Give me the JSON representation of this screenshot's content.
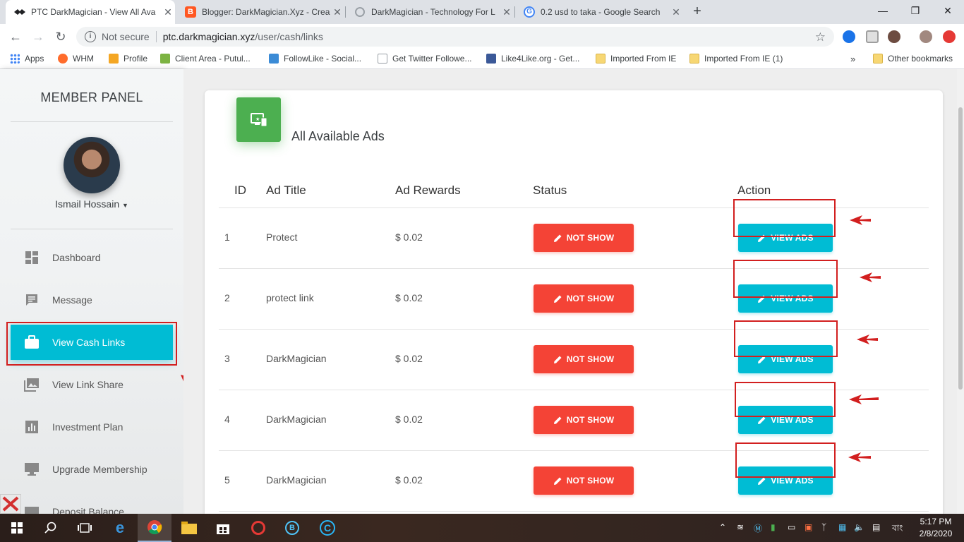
{
  "browser": {
    "tabs": [
      {
        "title": "PTC DarkMagician - View All Ava",
        "active": true
      },
      {
        "title": "Blogger: DarkMagician.Xyz - Crea",
        "active": false
      },
      {
        "title": "DarkMagician - Technology For L",
        "active": false
      },
      {
        "title": "0.2 usd to taka - Google Search",
        "active": false
      }
    ],
    "security_label": "Not secure",
    "url_host": "ptc.darkmagician.xyz",
    "url_path": "/user/cash/links",
    "bookmarks": [
      {
        "label": "Apps"
      },
      {
        "label": "WHM"
      },
      {
        "label": "Profile"
      },
      {
        "label": "Client Area - Putul..."
      },
      {
        "label": "FollowLike - Social..."
      },
      {
        "label": "Get Twitter Followe..."
      },
      {
        "label": "Like4Like.org - Get..."
      },
      {
        "label": "Imported From IE"
      },
      {
        "label": "Imported From IE (1)"
      },
      {
        "label": "»"
      },
      {
        "label": "Other bookmarks"
      }
    ]
  },
  "sidebar": {
    "title": "MEMBER PANEL",
    "user_name": "Ismail Hossain",
    "menu": [
      {
        "label": "Dashboard",
        "icon": "dashboard-icon",
        "active": false
      },
      {
        "label": "Message",
        "icon": "message-icon",
        "active": false
      },
      {
        "label": "View Cash Links",
        "icon": "briefcase-icon",
        "active": true
      },
      {
        "label": "View Link Share",
        "icon": "photo-library-icon",
        "active": false
      },
      {
        "label": "Investment Plan",
        "icon": "bar-chart-icon",
        "active": false
      },
      {
        "label": "Upgrade Membership",
        "icon": "monitor-icon",
        "active": false
      },
      {
        "label": "Deposit Balance",
        "icon": "deposit-icon",
        "active": false
      }
    ]
  },
  "main": {
    "card_title": "All Available Ads",
    "columns": [
      "ID",
      "Ad Title",
      "Ad Rewards",
      "Status",
      "Action"
    ],
    "rows": [
      {
        "id": "1",
        "title": "Protect",
        "reward": "$ 0.02",
        "status": "NOT SHOW",
        "action": "VIEW ADS"
      },
      {
        "id": "2",
        "title": "protect link",
        "reward": "$ 0.02",
        "status": "NOT SHOW",
        "action": "VIEW ADS"
      },
      {
        "id": "3",
        "title": "DarkMagician",
        "reward": "$ 0.02",
        "status": "NOT SHOW",
        "action": "VIEW ADS"
      },
      {
        "id": "4",
        "title": "DarkMagician",
        "reward": "$ 0.02",
        "status": "NOT SHOW",
        "action": "VIEW ADS"
      },
      {
        "id": "5",
        "title": "DarkMagician",
        "reward": "$ 0.02",
        "status": "NOT SHOW",
        "action": "VIEW ADS"
      }
    ]
  },
  "taskbar": {
    "time": "5:17 PM",
    "date": "2/8/2020",
    "language": "বাং"
  },
  "colors": {
    "accent_cyan": "#00bcd4",
    "danger_red": "#f44336",
    "card_green": "#4caf50",
    "annotation_red": "#d21f1f"
  }
}
